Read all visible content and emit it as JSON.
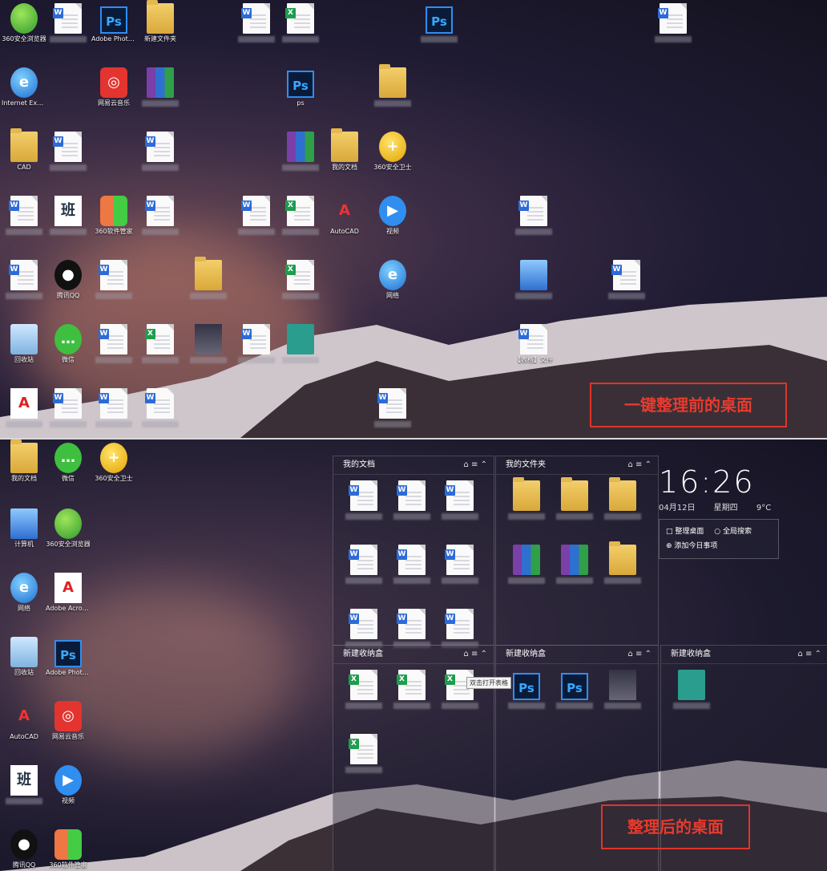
{
  "top_caption": "一键整理前的桌面",
  "bottom_caption": "整理后的桌面",
  "accent_color": "#e0342a",
  "top_icons": [
    {
      "type": "round-green",
      "label": "360安全浏览器"
    },
    {
      "type": "doc-w",
      "label": ""
    },
    {
      "type": "ps",
      "label": "Adobe Photosh..."
    },
    {
      "type": "folder-zip",
      "label": "新建文件夹"
    },
    {
      "type": "doc-w",
      "label": ""
    },
    {
      "type": "doc-x",
      "label": ""
    },
    {
      "type": "ps",
      "label": ""
    },
    {
      "type": "doc-w",
      "label": ""
    },
    {
      "type": "ie",
      "label": "Internet Explorer"
    },
    {
      "type": "netease",
      "label": "网易云音乐"
    },
    {
      "type": "rar",
      "label": ""
    },
    {
      "type": "ps",
      "label": "ps"
    },
    {
      "type": "folder",
      "label": ""
    },
    {
      "type": "folder",
      "label": "CAD"
    },
    {
      "type": "doc-w",
      "label": ""
    },
    {
      "type": "doc-w",
      "label": ""
    },
    {
      "type": "rar",
      "label": ""
    },
    {
      "type": "folder",
      "label": "我的文档"
    },
    {
      "type": "round-yellow",
      "label": "360安全卫士"
    },
    {
      "type": "doc-w",
      "label": ""
    },
    {
      "type": "ban",
      "label": ""
    },
    {
      "type": "apps",
      "label": "360软件管家"
    },
    {
      "type": "doc-w",
      "label": ""
    },
    {
      "type": "doc-w",
      "label": ""
    },
    {
      "type": "doc-x",
      "label": ""
    },
    {
      "type": "autocad",
      "label": "AutoCAD"
    },
    {
      "type": "video",
      "label": "视频"
    },
    {
      "type": "doc-w",
      "label": ""
    },
    {
      "type": "doc-w",
      "label": ""
    },
    {
      "type": "qq",
      "label": "腾讯QQ"
    },
    {
      "type": "doc-w",
      "label": ""
    },
    {
      "type": "folder",
      "label": ""
    },
    {
      "type": "doc-x",
      "label": ""
    },
    {
      "type": "globe",
      "label": "网络"
    },
    {
      "type": "pc",
      "label": ""
    },
    {
      "type": "doc-w",
      "label": ""
    },
    {
      "type": "bin",
      "label": "回收站"
    },
    {
      "type": "wechat",
      "label": "微信"
    },
    {
      "type": "doc-w",
      "label": ""
    },
    {
      "type": "doc-x",
      "label": ""
    },
    {
      "type": "img",
      "label": ""
    },
    {
      "type": "doc-w",
      "label": ""
    },
    {
      "type": "money",
      "label": ""
    },
    {
      "type": "doc-w",
      "label": "【表格】文件"
    },
    {
      "type": "pdf",
      "label": ""
    },
    {
      "type": "doc-w",
      "label": ""
    },
    {
      "type": "doc-w",
      "label": ""
    },
    {
      "type": "doc-w",
      "label": ""
    },
    {
      "type": "doc-w",
      "label": ""
    }
  ],
  "left_column": [
    {
      "type": "folder",
      "label": "我的文档"
    },
    {
      "type": "wechat",
      "label": "微信"
    },
    {
      "type": "round-yellow",
      "label": "360安全卫士"
    },
    {
      "type": "pc",
      "label": "计算机"
    },
    {
      "type": "round-green",
      "label": "360安全浏览器"
    },
    {
      "type": "globe",
      "label": "网络"
    },
    {
      "type": "pdf",
      "label": "Adobe Acrobat"
    },
    {
      "type": "bin",
      "label": "回收站"
    },
    {
      "type": "ps",
      "label": "Adobe Photoshop"
    },
    {
      "type": "autocad",
      "label": "AutoCAD"
    },
    {
      "type": "netease",
      "label": "网易云音乐"
    },
    {
      "type": "ban",
      "label": ""
    },
    {
      "type": "video",
      "label": "视频"
    },
    {
      "type": "qq",
      "label": "腾讯QQ"
    },
    {
      "type": "apps",
      "label": "360软件管家"
    }
  ],
  "fences": [
    {
      "title": "我的文档",
      "items": [
        "doc-w",
        "doc-w",
        "doc-w",
        "doc-w",
        "doc-w",
        "doc-w",
        "doc-w",
        "doc-w",
        "doc-w"
      ]
    },
    {
      "title": "我的文件夹",
      "items": [
        "folder-zip",
        "folder",
        "folder",
        "rar",
        "rar",
        "folder"
      ]
    },
    {
      "title": "新建收纳盒",
      "items": [
        "doc-x",
        "doc-x",
        "doc-x",
        "doc-x"
      ]
    },
    {
      "title": "新建收纳盒",
      "items": [
        "ps",
        "ps",
        "img"
      ]
    },
    {
      "title": "新建收纳盒",
      "items": [
        "money"
      ]
    }
  ],
  "tooltip": "双击打开表格",
  "clock": {
    "time": "16:26",
    "date": "04月12日",
    "weekday": "星期四",
    "temp": "9°C",
    "action1": "整理桌面",
    "action2": "全局搜索",
    "action3": "添加今日事项"
  }
}
